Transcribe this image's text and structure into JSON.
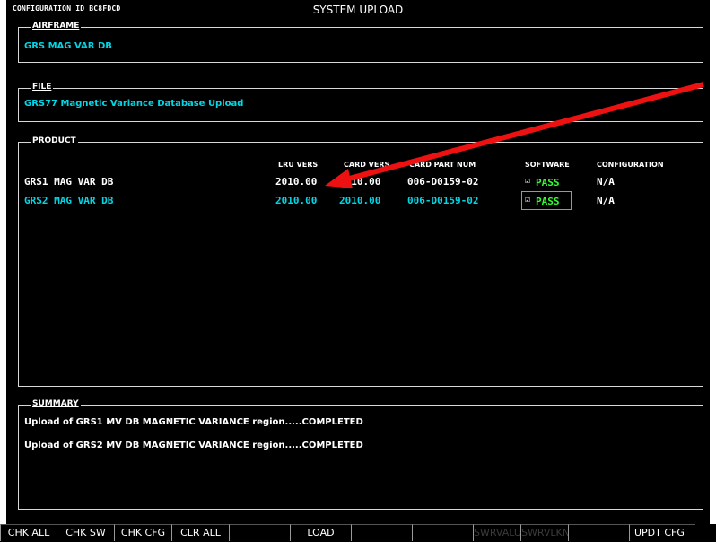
{
  "header": {
    "config_id": "CONFIGURATION ID BC8FDCD",
    "title": "SYSTEM UPLOAD"
  },
  "airframe": {
    "label": "AIRFRAME",
    "value": "GRS MAG VAR DB"
  },
  "file": {
    "label": "FILE",
    "value": "GRS77 Magnetic Variance Database Upload"
  },
  "product": {
    "label": "PRODUCT",
    "columns": {
      "lru_vers": "LRU VERS",
      "card_vers": "CARD VERS",
      "card_part_num": "CARD PART NUM",
      "software": "SOFTWARE",
      "configuration": "CONFIGURATION"
    },
    "rows": [
      {
        "name": "GRS1 MAG VAR DB",
        "lru_vers": "2010.00",
        "card_vers": "2010.00",
        "card_part_num": "006-D0159-02",
        "check": "☑",
        "software": "PASS",
        "configuration": "N/A"
      },
      {
        "name": "GRS2 MAG VAR DB",
        "lru_vers": "2010.00",
        "card_vers": "2010.00",
        "card_part_num": "006-D0159-02",
        "check": "☑",
        "software": "PASS",
        "configuration": "N/A"
      }
    ]
  },
  "summary": {
    "label": "SUMMARY",
    "lines": [
      "Upload of GRS1 MV DB MAGNETIC VARIANCE region.....COMPLETED",
      "Upload of GRS2 MV DB MAGNETIC VARIANCE region.....COMPLETED"
    ]
  },
  "softkeys": [
    {
      "label": "CHK ALL",
      "enabled": true
    },
    {
      "label": "CHK SW",
      "enabled": true
    },
    {
      "label": "CHK CFG",
      "enabled": true
    },
    {
      "label": "CLR ALL",
      "enabled": true
    },
    {
      "label": "",
      "enabled": false
    },
    {
      "label": "LOAD",
      "enabled": true
    },
    {
      "label": "",
      "enabled": false
    },
    {
      "label": "",
      "enabled": false
    },
    {
      "label": "SWRVALUP",
      "enabled": false
    },
    {
      "label": "SWRVLKN",
      "enabled": false
    },
    {
      "label": "",
      "enabled": false
    },
    {
      "label": "UPDT CFG",
      "enabled": true
    }
  ],
  "colors": {
    "accent_cyan": "#00d7e6",
    "pass_green": "#33ff33",
    "annotation_arrow": "#ee1111"
  }
}
